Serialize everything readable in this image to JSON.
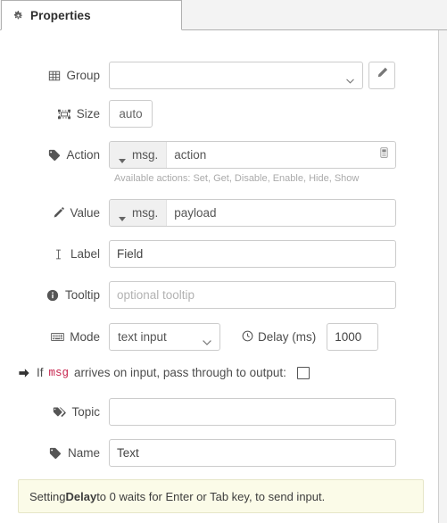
{
  "tab": {
    "label": "Properties",
    "icon": "gear-icon"
  },
  "rows": {
    "group": {
      "label": "Group",
      "icon": "table-icon",
      "value": "",
      "edit_icon": "pencil-icon"
    },
    "size": {
      "label": "Size",
      "icon": "object-group-icon",
      "value": "auto"
    },
    "action": {
      "label": "Action",
      "icon": "tag-icon",
      "type_prefix": "msg.",
      "value": "action",
      "expand_icon": "expand-editor-icon",
      "help": "Available actions: Set, Get, Disable, Enable, Hide, Show"
    },
    "value": {
      "label": "Value",
      "icon": "pencil-icon",
      "type_prefix": "msg.",
      "value": "payload"
    },
    "label_field": {
      "label": "Label",
      "icon": "text-width-icon",
      "value": "Field"
    },
    "tooltip": {
      "label": "Tooltip",
      "icon": "info-circle-icon",
      "value": "",
      "placeholder": "optional tooltip"
    },
    "mode": {
      "label": "Mode",
      "icon": "keyboard-icon",
      "value": "text input",
      "options": [
        "text input"
      ]
    },
    "delay": {
      "label": "Delay (ms)",
      "icon": "clock-icon",
      "value": "1000"
    },
    "passthrough": {
      "icon": "arrow-right-icon",
      "text_before": "If",
      "code": "msg",
      "text_after": "arrives on input, pass through to output:",
      "checked": false
    },
    "topic": {
      "label": "Topic",
      "icon": "tags-icon",
      "value": ""
    },
    "name": {
      "label": "Name",
      "icon": "tag-icon",
      "value": "Text"
    }
  },
  "note": {
    "prefix": "Setting ",
    "emphasis": "Delay",
    "suffix": " to 0 waits for Enter or Tab key, to send input."
  },
  "colors": {
    "panel_bg": "#ffffff",
    "chrome_bg": "#f3f3f3",
    "border": "#cccccc",
    "label_text": "#4d4d4d",
    "help_text": "#aaaaaa",
    "code_red": "#c7254e",
    "note_bg": "#fbfbe8",
    "note_border": "#e6e6c8"
  }
}
